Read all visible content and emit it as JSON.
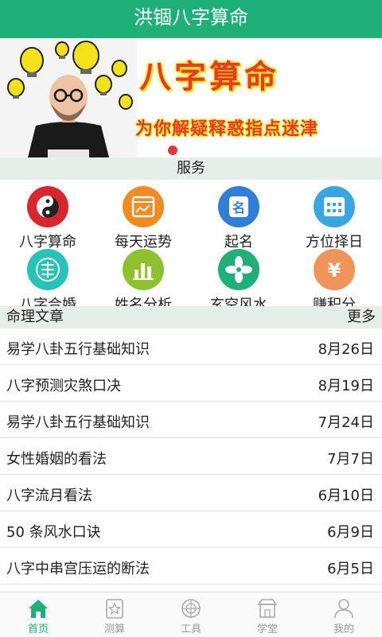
{
  "header": {
    "title": "洪锢八字算命"
  },
  "banner": {
    "headline": "八字算命",
    "subline": "为你解疑释惑指点迷津"
  },
  "services": {
    "title": "服务",
    "items": [
      {
        "label": "八字算命",
        "icon": "yin-yang-icon",
        "color": "#d9252b"
      },
      {
        "label": "每天运势",
        "icon": "calendar-chart-icon",
        "color": "#f08a22"
      },
      {
        "label": "起名",
        "icon": "name-tag-icon",
        "color": "#2f7fd6"
      },
      {
        "label": "方位择日",
        "icon": "calendar-grid-icon",
        "color": "#3aa6e0"
      },
      {
        "label": "八字合婚",
        "icon": "double-happiness-icon",
        "color": "#27c3b6"
      },
      {
        "label": "姓名分析",
        "icon": "bar-chart-icon",
        "color": "#8ec12f"
      },
      {
        "label": "玄空风水",
        "icon": "fan-icon",
        "color": "#1fb07a"
      },
      {
        "label": "赚积分",
        "icon": "yen-icon",
        "color": "#f0945a"
      }
    ]
  },
  "articles": {
    "title": "命理文章",
    "more": "更多",
    "items": [
      {
        "title": "易学八卦五行基础知识",
        "date": "8月26日"
      },
      {
        "title": "八字预测灾煞口决",
        "date": "8月19日"
      },
      {
        "title": "易学八卦五行基础知识",
        "date": "7月24日"
      },
      {
        "title": "女性婚姻的看法",
        "date": "7月7日"
      },
      {
        "title": "八字流月看法",
        "date": "6月10日"
      },
      {
        "title": "50 条风水口诀",
        "date": "6月9日"
      },
      {
        "title": "八字中串宫压运的断法",
        "date": "6月5日"
      }
    ]
  },
  "tabs": [
    {
      "label": "首页",
      "icon": "home-icon",
      "active": true
    },
    {
      "label": "测算",
      "icon": "star-book-icon",
      "active": false
    },
    {
      "label": "工具",
      "icon": "compass-icon",
      "active": false
    },
    {
      "label": "学堂",
      "icon": "school-icon",
      "active": false
    },
    {
      "label": "我的",
      "icon": "user-icon",
      "active": false
    }
  ]
}
